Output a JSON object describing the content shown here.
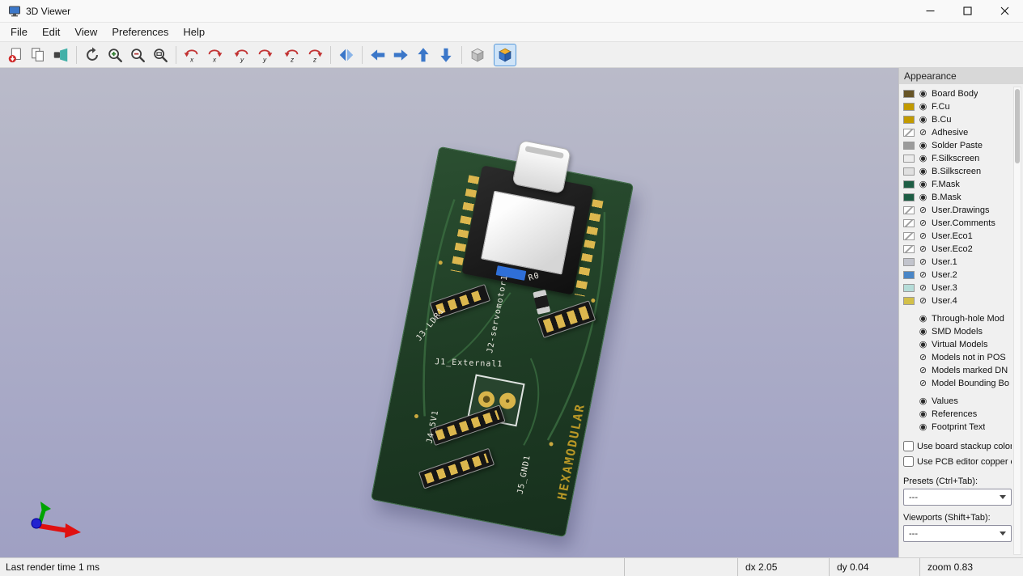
{
  "window": {
    "title": "3D Viewer"
  },
  "menu": {
    "items": [
      "File",
      "Edit",
      "View",
      "Preferences",
      "Help"
    ]
  },
  "toolbar": {
    "buttons": [
      "export-image",
      "copy-to-clipboard",
      "raytracing-render",
      "reload-board",
      "zoom-in",
      "zoom-out",
      "zoom-to-fit",
      "rotate-x-ccw",
      "rotate-x-cw",
      "rotate-y-ccw",
      "rotate-y-cw",
      "rotate-z-ccw",
      "rotate-z-cw",
      "flip-board",
      "move-left",
      "move-right",
      "move-up",
      "move-down",
      "orthographic-projection",
      "perspective-projection"
    ],
    "active_button": "perspective-projection",
    "rot_letters": [
      "x",
      "x",
      "y",
      "y",
      "z",
      "z"
    ]
  },
  "viewport": {
    "board": {
      "labels": {
        "j3": "J3-LDR1",
        "j2": "J2-servomotor1",
        "r0": "R0",
        "j1": "J1_External1",
        "j4": "J4_5V1",
        "j5": "J5_GND1",
        "brand": "HEXAMODULAR"
      }
    }
  },
  "appearance": {
    "title": "Appearance",
    "colors": {
      "board_green": "#1e3b24",
      "copper_gold": "#c29a00",
      "selection_blue": "#5a9ad9"
    },
    "layers": [
      {
        "label": "Board Body",
        "eye": "◉",
        "swatch": "background:#665426"
      },
      {
        "label": "F.Cu",
        "eye": "◉",
        "swatch": "background:#c29a00"
      },
      {
        "label": "B.Cu",
        "eye": "◉",
        "swatch": "background:#c29a00"
      },
      {
        "label": "Adhesive",
        "eye": "⊘",
        "swatch": "background:linear-gradient(135deg,#ffffff 40%,#9a9a9a 47%,#9a9a9a 53%,#ffffff 60%)"
      },
      {
        "label": "Solder Paste",
        "eye": "◉",
        "swatch": "background:#9b9b9b"
      },
      {
        "label": "F.Silkscreen",
        "eye": "◉",
        "swatch": "background:#ececec"
      },
      {
        "label": "B.Silkscreen",
        "eye": "◉",
        "swatch": "background:#e0e0e0"
      },
      {
        "label": "F.Mask",
        "eye": "◉",
        "swatch": "background:#1d5d44"
      },
      {
        "label": "B.Mask",
        "eye": "◉",
        "swatch": "background:#1d5d44"
      },
      {
        "label": "User.Drawings",
        "eye": "⊘",
        "swatch": "background:linear-gradient(135deg,#ffffff 40%,#9a9a9a 47%,#9a9a9a 53%,#ffffff 60%)"
      },
      {
        "label": "User.Comments",
        "eye": "⊘",
        "swatch": "background:linear-gradient(135deg,#ffffff 40%,#9a9a9a 47%,#9a9a9a 53%,#ffffff 60%)"
      },
      {
        "label": "User.Eco1",
        "eye": "⊘",
        "swatch": "background:linear-gradient(135deg,#ffffff 40%,#9a9a9a 47%,#9a9a9a 53%,#ffffff 60%)"
      },
      {
        "label": "User.Eco2",
        "eye": "⊘",
        "swatch": "background:linear-gradient(135deg,#ffffff 40%,#9a9a9a 47%,#9a9a9a 53%,#ffffff 60%)"
      },
      {
        "label": "User.1",
        "eye": "⊘",
        "swatch": "background:#c2c4cc"
      },
      {
        "label": "User.2",
        "eye": "⊘",
        "swatch": "background:#4a86c7"
      },
      {
        "label": "User.3",
        "eye": "⊘",
        "swatch": "background:#b5dcd8"
      },
      {
        "label": "User.4",
        "eye": "⊘",
        "swatch": "background:#d3c04a"
      }
    ],
    "models": [
      {
        "label": "Through-hole Mod",
        "eye": "◉"
      },
      {
        "label": "SMD Models",
        "eye": "◉"
      },
      {
        "label": "Virtual Models",
        "eye": "◉"
      },
      {
        "label": "Models not in POS",
        "eye": "⊘"
      },
      {
        "label": "Models marked DN",
        "eye": "⊘"
      },
      {
        "label": "Model Bounding Bo",
        "eye": "⊘"
      }
    ],
    "text_layers": [
      {
        "label": "Values",
        "eye": "◉"
      },
      {
        "label": "References",
        "eye": "◉"
      },
      {
        "label": "Footprint Text",
        "eye": "◉"
      }
    ],
    "checkboxes": [
      {
        "label": "Use board stackup colors",
        "checked": false
      },
      {
        "label": "Use PCB editor copper colo",
        "checked": false
      }
    ],
    "presets": {
      "label": "Presets (Ctrl+Tab):",
      "value": "---"
    },
    "viewports": {
      "label": "Viewports (Shift+Tab):",
      "value": "---"
    }
  },
  "status": {
    "render_time": "Last render time 1 ms",
    "dx": "dx 2.05",
    "dy": "dy 0.04",
    "zoom": "zoom 0.83"
  }
}
